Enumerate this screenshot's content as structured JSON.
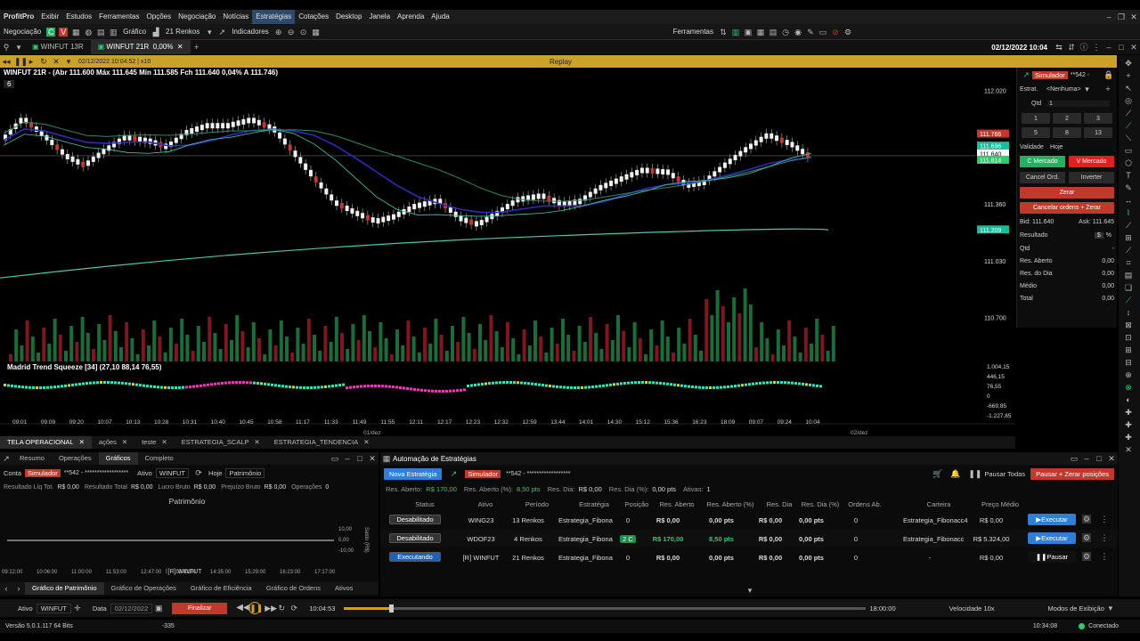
{
  "menu": {
    "logo": "ProfitPro",
    "items": [
      "Exibir",
      "Estudos",
      "Ferramentas",
      "Opções",
      "Negociação",
      "Notícias",
      "Estratégias",
      "Cotações",
      "Desktop",
      "Janela",
      "Aprenda",
      "Ajuda"
    ]
  },
  "toolbar": {
    "negociacao": "Negociação",
    "grafico": "Gráfico",
    "renkos": "21 Renkos",
    "indicadores": "Indicadores",
    "ferramentas": "Ferramentas"
  },
  "tabs": [
    {
      "label": "WINFUT 13R"
    },
    {
      "label": "WINFUT 21R",
      "extra": "0,00%"
    }
  ],
  "window": {
    "datetime": "02/12/2022 10:04"
  },
  "replay": {
    "datetime": "02/12/2022 10:04:52 | x10",
    "label": "Replay"
  },
  "chart": {
    "header": "WINFUT 21R - (Abr 111.600 Máx 111.645 Mín 111.585 Fch 111.640 0,04% A 111.746)",
    "level": "6",
    "indicator_label": "Madrid Trend Squeeze [34] (27,10 88,14 76,55)",
    "price_ticks": [
      "112.020",
      "111.360",
      "111.030",
      "110.700"
    ],
    "price_tags": [
      {
        "v": "111.766",
        "c": "#c0392b"
      },
      {
        "v": "111.696",
        "c": "#1abc9c"
      },
      {
        "v": "111.640",
        "c": "#ffffff"
      },
      {
        "v": "111.614",
        "c": "#2ecc71"
      },
      {
        "v": "111.209",
        "c": "#1abc9c"
      }
    ],
    "ind_ticks": [
      "1.004,15",
      "446,15",
      "76,55",
      "0",
      "-669,85",
      "-1.227,85"
    ],
    "time_ticks": [
      "09:01",
      "09:09",
      "09:20",
      "10:07",
      "10:13",
      "10:28",
      "10:31",
      "10:40",
      "10:45",
      "10:58",
      "11:17",
      "11:33",
      "11:49",
      "11:55",
      "12:11",
      "12:17",
      "12:23",
      "12:32",
      "12:59",
      "13:44",
      "14:01",
      "14:30",
      "15:12",
      "15:36",
      "16:23",
      "18:09",
      "09:07",
      "09:24",
      "10:04"
    ],
    "date_ticks": [
      "01/dez",
      "02/dez"
    ]
  },
  "chart_data": {
    "type": "line",
    "note_x": "renko brick index",
    "x": [
      0,
      4,
      8,
      12,
      16,
      20,
      24,
      28,
      32,
      36,
      40,
      44,
      48,
      52,
      56,
      60,
      64,
      68,
      72,
      76,
      80,
      84,
      88,
      92,
      96,
      100,
      104,
      108,
      112,
      116,
      120,
      124,
      128,
      132,
      136,
      140,
      144,
      148,
      152,
      156
    ],
    "series": [
      {
        "name": "Fch",
        "values": [
          111730,
          111860,
          111760,
          111650,
          111590,
          111680,
          111760,
          111740,
          111700,
          111790,
          111830,
          111830,
          111860,
          111810,
          111670,
          111520,
          111380,
          111320,
          111270,
          111300,
          111360,
          111390,
          111290,
          111250,
          111320,
          111400,
          111420,
          111370,
          111390,
          111470,
          111520,
          111570,
          111560,
          111480,
          111500,
          111600,
          111690,
          111770,
          111720,
          111640
        ]
      }
    ],
    "ylim": [
      110600,
      112100
    ]
  },
  "right_panel": {
    "mode": "Simulador",
    "account": "**542 -",
    "estrat_label": "Estrat.",
    "estrat_value": "<Nenhuma>",
    "qtd_label": "Qtd",
    "qtd_value": "1",
    "qty_buttons": [
      "1",
      "2",
      "3",
      "5",
      "8",
      "13"
    ],
    "validade_label": "Validade",
    "validade_value": "Hoje",
    "c_mercado": "C Mercado",
    "v_mercado": "V Mercado",
    "cancel_ord": "Cancel Ord.",
    "inverter": "Inverter",
    "zerar": "Zerar",
    "cancel_zerar": "Cancelar ordens + Zerar",
    "bid": "Bid: 111.640",
    "ask": "Ask: 111.645",
    "resultado": "Resultado",
    "currency": "$",
    "pct": "%",
    "rows": [
      {
        "label": "Qtd",
        "value": "-"
      },
      {
        "label": "Res. Aberto",
        "value": "0,00"
      },
      {
        "label": "Res. do Dia",
        "value": "0,00"
      },
      {
        "label": "Médio",
        "value": "0,00"
      },
      {
        "label": "Total",
        "value": "0,00"
      }
    ]
  },
  "bottom_tabs": [
    "TELA OPERACIONAL",
    "ações",
    "teste",
    "ESTRATEGIA_SCALP",
    "ESTRATEGIA_TENDENCIA"
  ],
  "left_bottom": {
    "tabs": [
      "Resumo",
      "Operações",
      "Gráficos",
      "Completo"
    ],
    "conta": "Conta",
    "sim": "Simulador",
    "account": "**542 - ******************",
    "ativo_label": "Ativo",
    "ativo": "WINFUT",
    "hoje": "Hoje",
    "patrimonio_sel": "Patrimônio",
    "stats": [
      {
        "l": "Resultado Líq Tot.",
        "v": "R$ 0,00"
      },
      {
        "l": "Resultado Total",
        "v": "R$ 0,00"
      },
      {
        "l": "Lucro Bruto",
        "v": "R$ 0,00"
      },
      {
        "l": "Prejuízo Bruto",
        "v": "R$ 0,00"
      },
      {
        "l": "Operações",
        "v": "0"
      }
    ],
    "title": "Patrimônio",
    "y_ticks": [
      "10,00",
      "0,00",
      "-10,00"
    ],
    "y_label": "Saldo (R$)",
    "x_ticks": [
      "09:12:00",
      "10:06:00",
      "11:00:00",
      "11:53:00",
      "12:47:00",
      "13:41:00",
      "14:35:00",
      "15:29:00",
      "16:23:00",
      "17:17:00"
    ],
    "legend": "[R] WINFUT",
    "bottom_tabs": [
      "Gráfico de Patrimônio",
      "Gráfico de Operações",
      "Gráfico de Eficiência",
      "Gráfico de Ordens",
      "Ativos"
    ]
  },
  "auto": {
    "title": "Automação de Estratégias",
    "nova": "Nova Estratégia",
    "sim": "Simulador",
    "account": "**542 - ******************",
    "pausar_todas": "Pausar Todas",
    "pausar_zerar": "Pausar + Zerar posições",
    "summary": [
      {
        "l": "Res. Aberto:",
        "v": "R$ 170,00"
      },
      {
        "l": "Res. Aberto (%):",
        "v": "8,50 pts"
      },
      {
        "l": "Res. Dia:",
        "v": "R$ 0,00"
      },
      {
        "l": "Res. Dia (%):",
        "v": "0,00 pts"
      },
      {
        "l": "Ativas:",
        "v": "1"
      }
    ],
    "columns": [
      "Status",
      "Ativo",
      "Período",
      "Estratégia",
      "Posição",
      "Res. Aberto",
      "Res. Aberto (%)",
      "Res. Dia",
      "Res. Dia (%)",
      "Ordens Ab.",
      "Carteira",
      "Preço Médio"
    ],
    "rows": [
      {
        "status": "Desabilitado",
        "ativo": "WING23",
        "periodo": "13 Renkos",
        "estrategia": "Estrategia_Fibona",
        "posicao": "0",
        "res_aberto": "R$ 0,00",
        "res_aberto_pct": "0,00 pts",
        "res_dia": "R$ 0,00",
        "res_dia_pct": "0,00 pts",
        "ordens": "0",
        "carteira": "Estrategia_Fibonacc4",
        "preco": "R$ 0,00",
        "action": "Executar"
      },
      {
        "status": "Desabilitado",
        "ativo": "WDOF23",
        "periodo": "4 Renkos",
        "estrategia": "Estrategia_Fibona",
        "posicao": "2 C",
        "res_aberto": "R$ 170,00",
        "res_aberto_pct": "8,50 pts",
        "res_dia": "R$ 0,00",
        "res_dia_pct": "0,00 pts",
        "ordens": "0",
        "carteira": "Estrategia_Fibonacc",
        "preco": "R$ 5.324,00",
        "action": "Executar"
      },
      {
        "status": "Executando",
        "ativo": "[R] WINFUT",
        "periodo": "21 Renkos",
        "estrategia": "Estrategia_Fibona",
        "posicao": "0",
        "res_aberto": "R$ 0,00",
        "res_aberto_pct": "0,00 pts",
        "res_dia": "R$ 0,00",
        "res_dia_pct": "0,00 pts",
        "ordens": "0",
        "carteira": "-",
        "preco": "R$ 0,00",
        "action": "Pausar"
      }
    ]
  },
  "player": {
    "ativo_label": "Ativo",
    "ativo": "WINFUT",
    "data_label": "Data",
    "data": "02/12/2022",
    "finalizar": "Finalizar",
    "time": "10:04:53",
    "end_time": "18:00:00",
    "velocidade": "Velocidade 10x",
    "modos": "Modos de Exibição",
    "progress": 0.09
  },
  "status": {
    "version": "Versão 5.0.1.117 64 Bits",
    "value": "-335",
    "clock": "10:34:08",
    "conn": "Conectado"
  }
}
